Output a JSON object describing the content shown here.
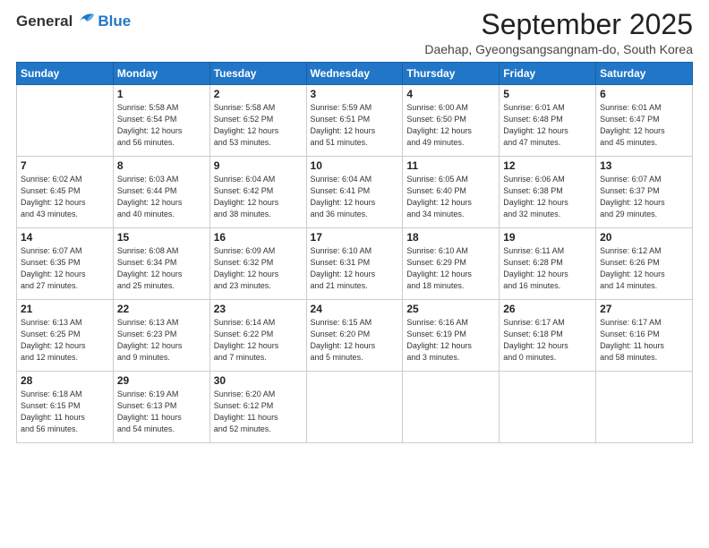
{
  "logo": {
    "general": "General",
    "blue": "Blue"
  },
  "header": {
    "title": "September 2025",
    "subtitle": "Daehap, Gyeongsangsangnam-do, South Korea"
  },
  "weekdays": [
    "Sunday",
    "Monday",
    "Tuesday",
    "Wednesday",
    "Thursday",
    "Friday",
    "Saturday"
  ],
  "weeks": [
    [
      {
        "day": "",
        "sunrise": "",
        "sunset": "",
        "daylight": ""
      },
      {
        "day": "1",
        "sunrise": "Sunrise: 5:58 AM",
        "sunset": "Sunset: 6:54 PM",
        "daylight": "Daylight: 12 hours and 56 minutes."
      },
      {
        "day": "2",
        "sunrise": "Sunrise: 5:58 AM",
        "sunset": "Sunset: 6:52 PM",
        "daylight": "Daylight: 12 hours and 53 minutes."
      },
      {
        "day": "3",
        "sunrise": "Sunrise: 5:59 AM",
        "sunset": "Sunset: 6:51 PM",
        "daylight": "Daylight: 12 hours and 51 minutes."
      },
      {
        "day": "4",
        "sunrise": "Sunrise: 6:00 AM",
        "sunset": "Sunset: 6:50 PM",
        "daylight": "Daylight: 12 hours and 49 minutes."
      },
      {
        "day": "5",
        "sunrise": "Sunrise: 6:01 AM",
        "sunset": "Sunset: 6:48 PM",
        "daylight": "Daylight: 12 hours and 47 minutes."
      },
      {
        "day": "6",
        "sunrise": "Sunrise: 6:01 AM",
        "sunset": "Sunset: 6:47 PM",
        "daylight": "Daylight: 12 hours and 45 minutes."
      }
    ],
    [
      {
        "day": "7",
        "sunrise": "Sunrise: 6:02 AM",
        "sunset": "Sunset: 6:45 PM",
        "daylight": "Daylight: 12 hours and 43 minutes."
      },
      {
        "day": "8",
        "sunrise": "Sunrise: 6:03 AM",
        "sunset": "Sunset: 6:44 PM",
        "daylight": "Daylight: 12 hours and 40 minutes."
      },
      {
        "day": "9",
        "sunrise": "Sunrise: 6:04 AM",
        "sunset": "Sunset: 6:42 PM",
        "daylight": "Daylight: 12 hours and 38 minutes."
      },
      {
        "day": "10",
        "sunrise": "Sunrise: 6:04 AM",
        "sunset": "Sunset: 6:41 PM",
        "daylight": "Daylight: 12 hours and 36 minutes."
      },
      {
        "day": "11",
        "sunrise": "Sunrise: 6:05 AM",
        "sunset": "Sunset: 6:40 PM",
        "daylight": "Daylight: 12 hours and 34 minutes."
      },
      {
        "day": "12",
        "sunrise": "Sunrise: 6:06 AM",
        "sunset": "Sunset: 6:38 PM",
        "daylight": "Daylight: 12 hours and 32 minutes."
      },
      {
        "day": "13",
        "sunrise": "Sunrise: 6:07 AM",
        "sunset": "Sunset: 6:37 PM",
        "daylight": "Daylight: 12 hours and 29 minutes."
      }
    ],
    [
      {
        "day": "14",
        "sunrise": "Sunrise: 6:07 AM",
        "sunset": "Sunset: 6:35 PM",
        "daylight": "Daylight: 12 hours and 27 minutes."
      },
      {
        "day": "15",
        "sunrise": "Sunrise: 6:08 AM",
        "sunset": "Sunset: 6:34 PM",
        "daylight": "Daylight: 12 hours and 25 minutes."
      },
      {
        "day": "16",
        "sunrise": "Sunrise: 6:09 AM",
        "sunset": "Sunset: 6:32 PM",
        "daylight": "Daylight: 12 hours and 23 minutes."
      },
      {
        "day": "17",
        "sunrise": "Sunrise: 6:10 AM",
        "sunset": "Sunset: 6:31 PM",
        "daylight": "Daylight: 12 hours and 21 minutes."
      },
      {
        "day": "18",
        "sunrise": "Sunrise: 6:10 AM",
        "sunset": "Sunset: 6:29 PM",
        "daylight": "Daylight: 12 hours and 18 minutes."
      },
      {
        "day": "19",
        "sunrise": "Sunrise: 6:11 AM",
        "sunset": "Sunset: 6:28 PM",
        "daylight": "Daylight: 12 hours and 16 minutes."
      },
      {
        "day": "20",
        "sunrise": "Sunrise: 6:12 AM",
        "sunset": "Sunset: 6:26 PM",
        "daylight": "Daylight: 12 hours and 14 minutes."
      }
    ],
    [
      {
        "day": "21",
        "sunrise": "Sunrise: 6:13 AM",
        "sunset": "Sunset: 6:25 PM",
        "daylight": "Daylight: 12 hours and 12 minutes."
      },
      {
        "day": "22",
        "sunrise": "Sunrise: 6:13 AM",
        "sunset": "Sunset: 6:23 PM",
        "daylight": "Daylight: 12 hours and 9 minutes."
      },
      {
        "day": "23",
        "sunrise": "Sunrise: 6:14 AM",
        "sunset": "Sunset: 6:22 PM",
        "daylight": "Daylight: 12 hours and 7 minutes."
      },
      {
        "day": "24",
        "sunrise": "Sunrise: 6:15 AM",
        "sunset": "Sunset: 6:20 PM",
        "daylight": "Daylight: 12 hours and 5 minutes."
      },
      {
        "day": "25",
        "sunrise": "Sunrise: 6:16 AM",
        "sunset": "Sunset: 6:19 PM",
        "daylight": "Daylight: 12 hours and 3 minutes."
      },
      {
        "day": "26",
        "sunrise": "Sunrise: 6:17 AM",
        "sunset": "Sunset: 6:18 PM",
        "daylight": "Daylight: 12 hours and 0 minutes."
      },
      {
        "day": "27",
        "sunrise": "Sunrise: 6:17 AM",
        "sunset": "Sunset: 6:16 PM",
        "daylight": "Daylight: 11 hours and 58 minutes."
      }
    ],
    [
      {
        "day": "28",
        "sunrise": "Sunrise: 6:18 AM",
        "sunset": "Sunset: 6:15 PM",
        "daylight": "Daylight: 11 hours and 56 minutes."
      },
      {
        "day": "29",
        "sunrise": "Sunrise: 6:19 AM",
        "sunset": "Sunset: 6:13 PM",
        "daylight": "Daylight: 11 hours and 54 minutes."
      },
      {
        "day": "30",
        "sunrise": "Sunrise: 6:20 AM",
        "sunset": "Sunset: 6:12 PM",
        "daylight": "Daylight: 11 hours and 52 minutes."
      },
      {
        "day": "",
        "sunrise": "",
        "sunset": "",
        "daylight": ""
      },
      {
        "day": "",
        "sunrise": "",
        "sunset": "",
        "daylight": ""
      },
      {
        "day": "",
        "sunrise": "",
        "sunset": "",
        "daylight": ""
      },
      {
        "day": "",
        "sunrise": "",
        "sunset": "",
        "daylight": ""
      }
    ]
  ]
}
